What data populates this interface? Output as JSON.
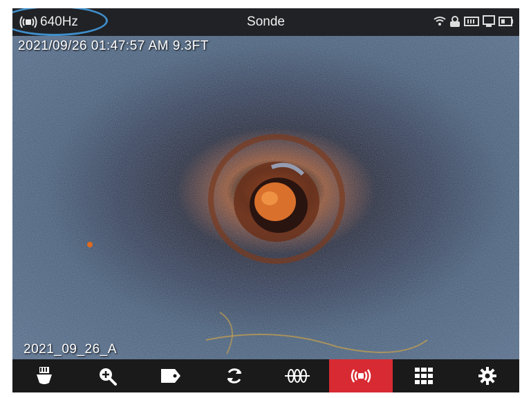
{
  "status_bar": {
    "frequency": "640Hz",
    "mode_title": "Sonde",
    "icons": [
      "wifi-icon",
      "battery-lock-icon",
      "memory-card-icon",
      "monitor-icon",
      "battery-icon"
    ]
  },
  "overlay": {
    "timestamp": "2021/09/26 01:47:57 AM 9.3FT",
    "filename": "2021_09_26_A"
  },
  "toolbar": {
    "items": [
      {
        "icon": "light-icon",
        "active": false
      },
      {
        "icon": "zoom-in-icon",
        "active": false
      },
      {
        "icon": "tag-icon",
        "active": false
      },
      {
        "icon": "rotate-icon",
        "active": false
      },
      {
        "icon": "line-locate-icon",
        "active": false
      },
      {
        "icon": "sonde-icon",
        "active": true
      },
      {
        "icon": "grid-menu-icon",
        "active": false
      },
      {
        "icon": "settings-gear-icon",
        "active": false
      }
    ]
  },
  "colors": {
    "active_tab": "#d82a32",
    "highlight_ring": "#3f8fcc",
    "status_bar": "#202226",
    "toolbar": "#1a1a1a"
  }
}
